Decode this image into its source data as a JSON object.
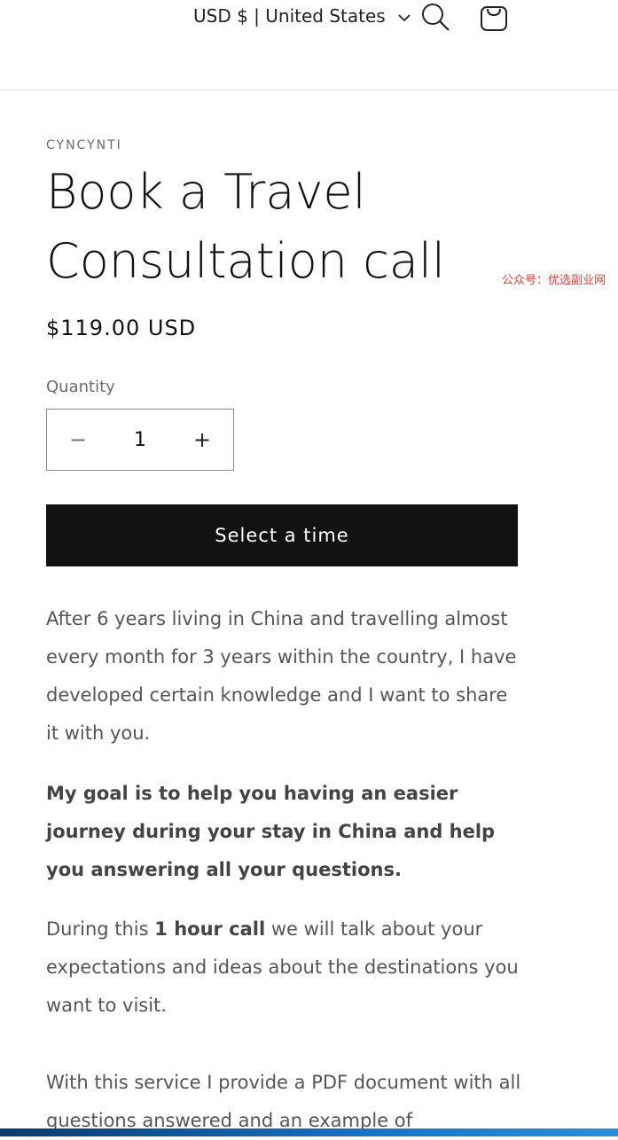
{
  "header": {
    "currency": "USD $ | United States",
    "icons": {
      "chevron": "chevron-down-icon",
      "search": "search-icon",
      "cart": "cart-icon"
    }
  },
  "product": {
    "vendor": "CYNCYNTI",
    "title": "Book a Travel Consultation call",
    "price": "$119.00 USD",
    "quantity_label": "Quantity",
    "quantity_value": "1",
    "minus_label": "−",
    "plus_label": "+",
    "cta_label": "Select a time"
  },
  "watermark": "公众号：优选副业网",
  "description": {
    "p1": "After 6 years living in China and travelling almost every month for 3 years within the country, I have developed certain knowledge and I want to share it with you.",
    "p2": "My goal is to help you having an easier journey during your stay in China and help you answering all your questions.",
    "p3_pre": "During this ",
    "p3_bold": "1 hour call",
    "p3_post": " we will talk about your expectations and ideas about the destinations you want to visit.",
    "p4": "With this service I provide a PDF document with all questions answered and an example of"
  },
  "colors": {
    "button_bg": "#121212",
    "watermark": "#e0403a",
    "bar": "#1a73c6"
  }
}
